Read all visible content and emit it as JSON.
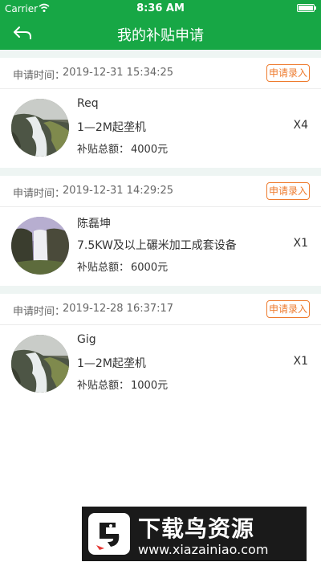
{
  "status_bar": {
    "carrier": "Carrier",
    "time": "8:36 AM"
  },
  "nav": {
    "title": "我的补贴申请"
  },
  "colors": {
    "brand_green": "#17a745",
    "accent_orange": "#ee7b2e"
  },
  "applications": [
    {
      "time_label": "申请时间：",
      "time": "2019-12-31 15:34:25",
      "entry_button": "申请录入",
      "name": "Req",
      "product": "1—2M起垄机",
      "quantity": "X4",
      "total_label": "补贴总额：",
      "total": "4000元"
    },
    {
      "time_label": "申请时间：",
      "time": "2019-12-31 14:29:25",
      "entry_button": "申请录入",
      "name": "陈磊坤",
      "product": "7.5KW及以上碾米加工成套设备",
      "quantity": "X1",
      "total_label": "补贴总额：",
      "total": "6000元"
    },
    {
      "time_label": "申请时间：",
      "time": "2019-12-28 16:37:17",
      "entry_button": "申请录入",
      "name": "Gig",
      "product": "1—2M起垄机",
      "quantity": "X1",
      "total_label": "补贴总额：",
      "total": "1000元"
    }
  ],
  "watermark": {
    "text": "下载鸟资源",
    "url": "www.xiazainiao.com"
  }
}
